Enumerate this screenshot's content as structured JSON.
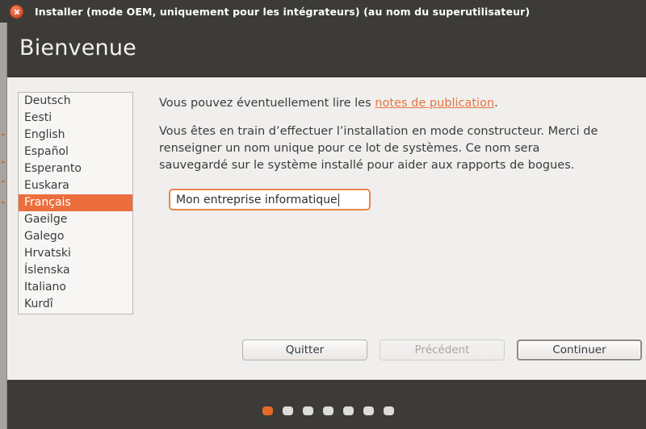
{
  "window": {
    "title": "Installer (mode OEM, uniquement pour les intégrateurs) (au nom du superutilisateur)",
    "close_icon": "close-icon",
    "close_label": "×"
  },
  "header": {
    "title": "Bienvenue"
  },
  "language_list": {
    "items": [
      {
        "label": "Deutsch",
        "selected": false
      },
      {
        "label": "Eesti",
        "selected": false
      },
      {
        "label": "English",
        "selected": false
      },
      {
        "label": "Español",
        "selected": false
      },
      {
        "label": "Esperanto",
        "selected": false
      },
      {
        "label": "Euskara",
        "selected": false
      },
      {
        "label": "Français",
        "selected": true
      },
      {
        "label": "Gaeilge",
        "selected": false
      },
      {
        "label": "Galego",
        "selected": false
      },
      {
        "label": "Hrvatski",
        "selected": false
      },
      {
        "label": "Íslenska",
        "selected": false
      },
      {
        "label": "Italiano",
        "selected": false
      },
      {
        "label": "Kurdî",
        "selected": false
      }
    ],
    "selected_value": "Français"
  },
  "main": {
    "intro_prefix": "Vous pouvez éventuellement lire les ",
    "release_notes_link": "notes de publication",
    "intro_suffix": ".",
    "paragraph": "Vous êtes en train d’effectuer l’installation en mode constructeur. Merci de renseigner un nom unique pour ce lot de systèmes. Ce nom sera sauvegardé sur le système installé pour aider aux rapports de bogues.",
    "name_input": {
      "value": "Mon entreprise informatique",
      "placeholder": ""
    }
  },
  "buttons": {
    "quit": "Quitter",
    "back": "Précédent",
    "continue": "Continuer"
  },
  "progress": {
    "total_steps": 7,
    "current_step": 1,
    "dots": [
      true,
      false,
      false,
      false,
      false,
      false,
      false
    ]
  },
  "colors": {
    "accent_orange": "#e8692a",
    "selection_orange": "#ec6e3d",
    "link_orange": "#e8743d",
    "chrome_dark": "#3c3b37",
    "content_bg": "#f0efee"
  }
}
